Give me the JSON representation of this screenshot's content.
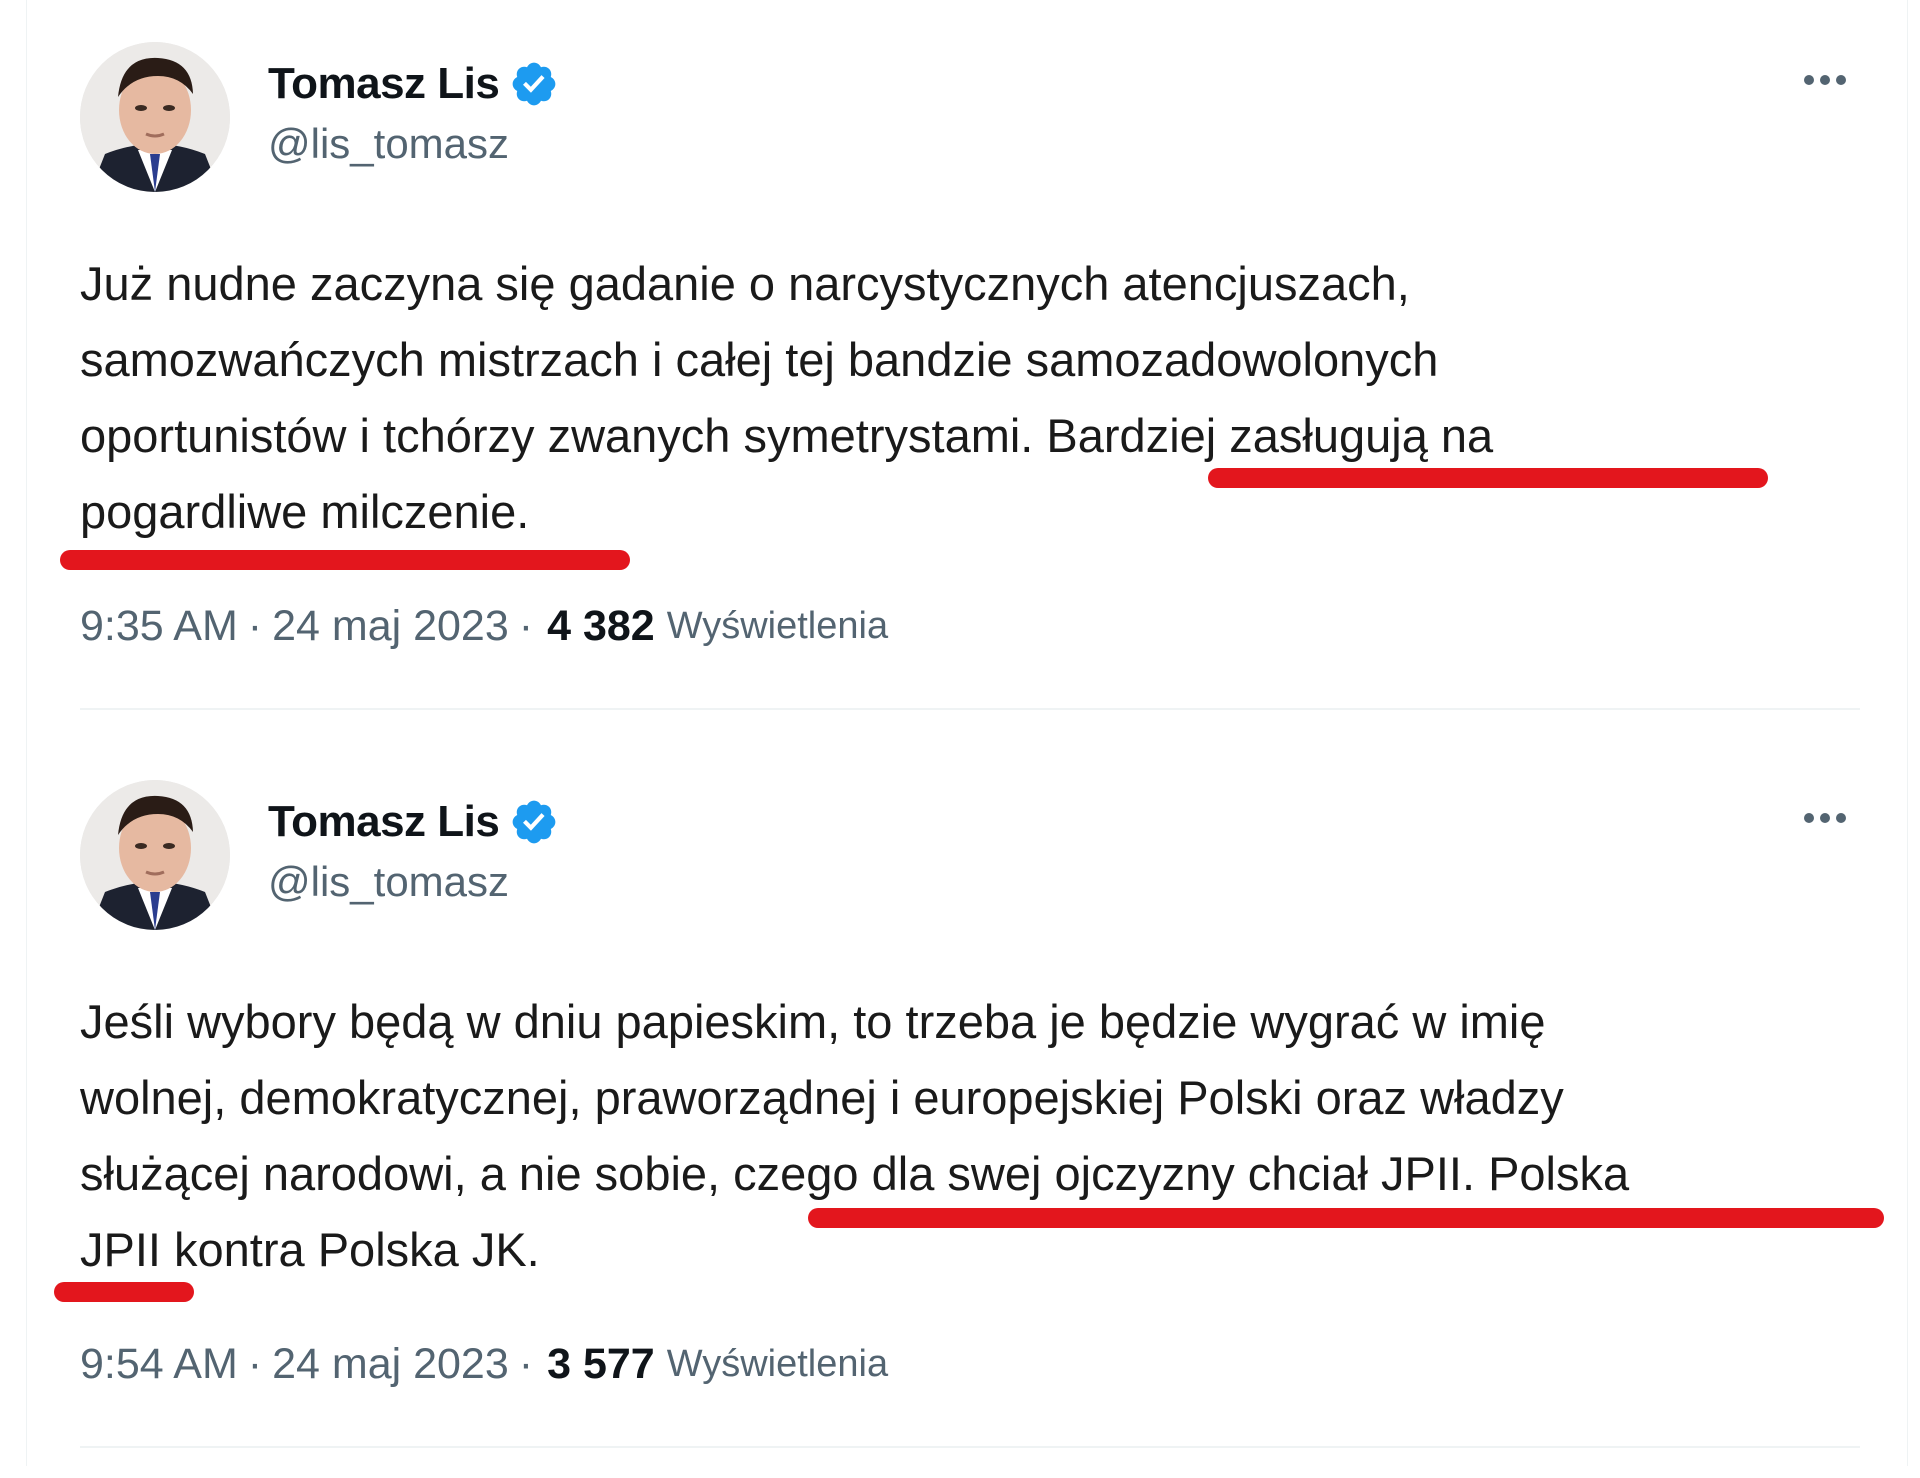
{
  "colors": {
    "verified_badge": "#1d9bf0",
    "highlight_underline": "#e3161d",
    "secondary_text": "#536471"
  },
  "tweets": [
    {
      "author": {
        "name": "Tomasz Lis",
        "handle": "@lis_tomasz",
        "verified_icon": "verified-badge-icon",
        "avatar_icon": "profile-photo"
      },
      "more_icon": "more-options-icon",
      "body": "Już nudne zaczyna się gadanie o narcystycznych atencjuszach,\nsamozwańczych mistrzach i całej tej bandzie samozadowolonych\noportunistów i tchórzy zwanych symetrystami. Bardziej zasługują na\npogardliwe milczenie.",
      "time": "9:35 AM",
      "separator": "·",
      "date": "24 maj 2023",
      "views_count": "4 382",
      "views_label": "Wyświetlenia"
    },
    {
      "author": {
        "name": "Tomasz Lis",
        "handle": "@lis_tomasz",
        "verified_icon": "verified-badge-icon",
        "avatar_icon": "profile-photo"
      },
      "more_icon": "more-options-icon",
      "body": "Jeśli wybory będą w dniu papieskim, to trzeba je będzie wygrać w imię\nwolnej, demokratycznej, praworządnej i europejskiej Polski oraz władzy\nsłużącej narodowi, a nie sobie, czego dla swej ojczyzny chciał JPII. Polska\nJPII kontra Polska JK.",
      "time": "9:54 AM",
      "separator": "·",
      "date": "24 maj 2023",
      "views_count": "3 577",
      "views_label": "Wyświetlenia"
    }
  ]
}
